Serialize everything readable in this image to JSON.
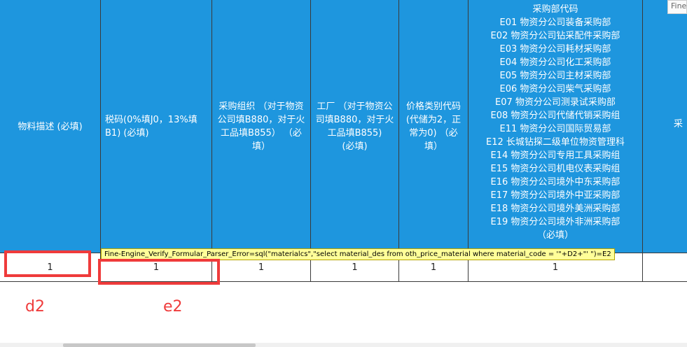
{
  "columns": [
    {
      "id": "d",
      "header_lines": [
        "物料描述 (必填)"
      ],
      "value": "1"
    },
    {
      "id": "e",
      "header_lines": [
        "税码(0%填J0，13%填",
        "B1) (必填)"
      ],
      "value": "1"
    },
    {
      "id": "f",
      "header_lines": [
        "采购组织 （对于物资",
        "公司填B880，对于火",
        "工品填B855） （必",
        "填）"
      ],
      "value": "1"
    },
    {
      "id": "g",
      "header_lines": [
        "工厂 （对于物资公",
        "司填B880，对于火",
        "工品填B855)",
        "(必填)"
      ],
      "value": "1"
    },
    {
      "id": "h",
      "header_lines": [
        "价格类别代码",
        "(代储为2，正",
        "常为0) （必",
        "填）"
      ],
      "value": "1"
    },
    {
      "id": "i",
      "header_lines": [
        "采购部代码",
        "E01 物资分公司装备采购部",
        "E02 物资分公司钻采配件采购部",
        "E03 物资分公司耗材采购部",
        "E04 物资分公司化工采购部",
        "E05 物资分公司主材采购部",
        "E06 物资分公司柴气采购部",
        "E07 物资分公司测录试采购部",
        "E08 物资分公司代储代销采购组",
        "E11 物资分公司国际贸易部",
        "E12 长城钻探二级单位物资管理科",
        "E14 物资分公司专用工具采购组",
        "E15 物资分公司机电仪表采购组",
        "E16 物资分公司境外中东采购部",
        "E17 物资分公司境外中亚采购部",
        "E18 物资分公司境外美洲采购部",
        "E19 物资分公司境外非洲采购部",
        "（必填）"
      ],
      "value": "1"
    }
  ],
  "partial_column_header": "采",
  "error_tooltip": "Fine-Engine_Verify_Formular_Parser_Error=sql(\"materialcs\",\"select material_des from oth_price_material where material_code = '\"+D2+\"' \")=E2",
  "fine_tip": "Fine",
  "annotations": {
    "d2": "d2",
    "e2": "e2"
  },
  "colors": {
    "header_bg": "#1e96de",
    "annotation_red": "#ef3b3b",
    "tooltip_bg": "#ffff99"
  }
}
